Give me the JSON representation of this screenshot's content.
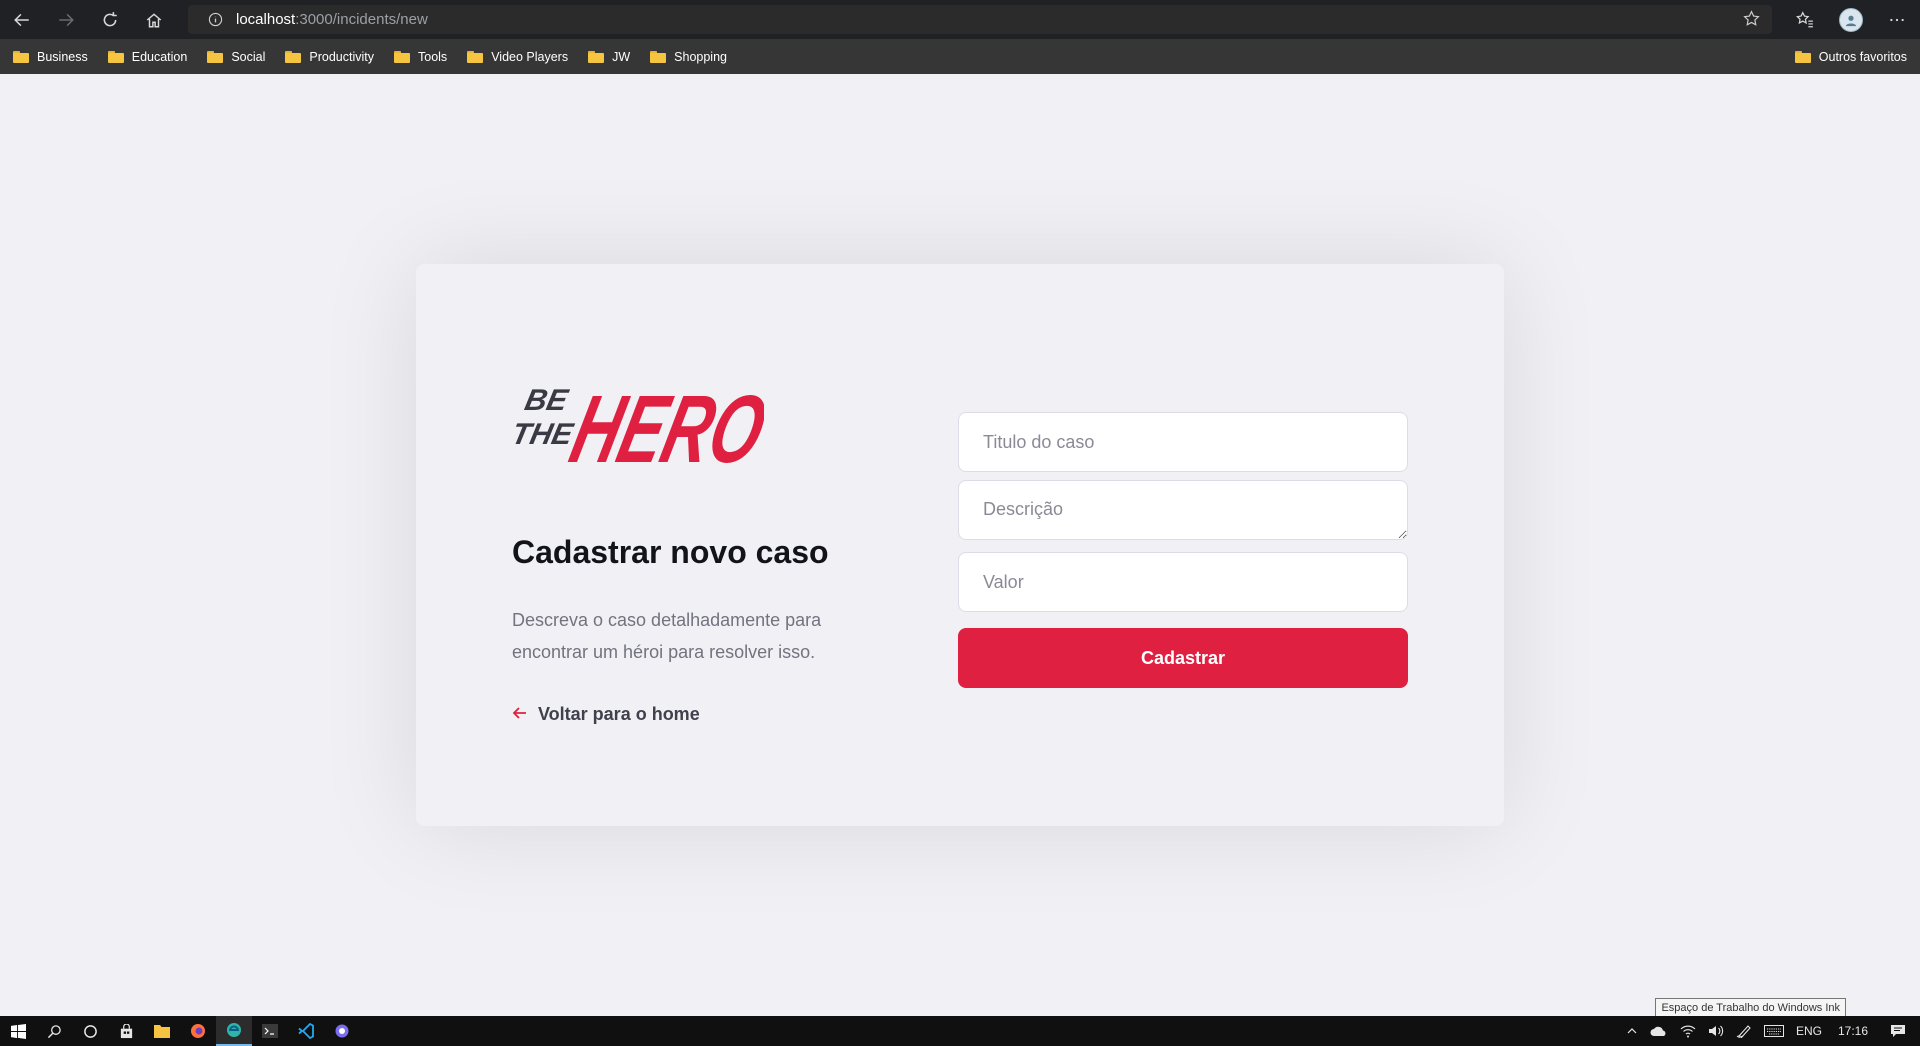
{
  "browser": {
    "url_host": "localhost",
    "url_path": ":3000/incidents/new",
    "bookmarks": [
      {
        "label": "Business"
      },
      {
        "label": "Education"
      },
      {
        "label": "Social"
      },
      {
        "label": "Productivity"
      },
      {
        "label": "Tools"
      },
      {
        "label": "Video Players"
      },
      {
        "label": "JW"
      },
      {
        "label": "Shopping"
      }
    ],
    "other_favorites": "Outros favoritos"
  },
  "page": {
    "logo": {
      "line1": "BE",
      "line2": "THE",
      "word": "HERO"
    },
    "title": "Cadastrar novo caso",
    "description": "Descreva o caso detalhadamente para encontrar um héroi para resolver isso.",
    "back_link": "Voltar para o home",
    "form": {
      "title_placeholder": "Titulo do caso",
      "description_placeholder": "Descrição",
      "value_placeholder": "Valor",
      "submit_label": "Cadastrar"
    },
    "colors": {
      "accent": "#e02041",
      "background": "#f0f0f5",
      "dark": "#13131a"
    }
  },
  "tooltip": "Espaço de Trabalho do Windows Ink",
  "taskbar": {
    "language": "ENG",
    "clock": "17:16"
  }
}
